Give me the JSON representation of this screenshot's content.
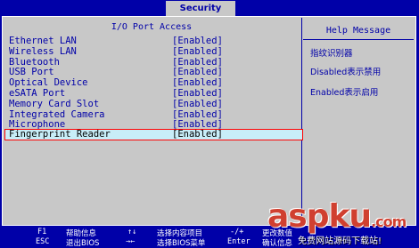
{
  "tabs": {
    "active": "Security"
  },
  "page": {
    "title": "I/O Port Access"
  },
  "items": [
    {
      "name": "Ethernet LAN",
      "value": "[Enabled]"
    },
    {
      "name": "Wireless LAN",
      "value": "[Enabled]"
    },
    {
      "name": "Bluetooth",
      "value": "[Enabled]"
    },
    {
      "name": "USB Port",
      "value": "[Enabled]"
    },
    {
      "name": "Optical Device",
      "value": "[Enabled]"
    },
    {
      "name": "eSATA Port",
      "value": "[Enabled]"
    },
    {
      "name": "Memory Card Slot",
      "value": "[Enabled]"
    },
    {
      "name": "Integrated Camera",
      "value": "[Enabled]"
    },
    {
      "name": "Microphone",
      "value": "[Enabled]"
    },
    {
      "name": "Fingerprint Reader",
      "value": "[Enabled]",
      "selected": true
    }
  ],
  "help": {
    "title": "Help Message",
    "lines": [
      "指纹识别器",
      "Disabled表示禁用",
      "Enabled表示启用"
    ]
  },
  "footer": {
    "f1_key": "F1",
    "f1_desc": "帮助信息",
    "esc_key": "ESC",
    "esc_desc": "退出BIOS",
    "updown_key": "↑↓",
    "updown_desc": "选择内容项目",
    "leftright_key": "→←",
    "leftright_desc": "选择BIOS菜单",
    "plusminus_key": "-/+",
    "plusminus_desc": "更改数值",
    "enter_key": "Enter",
    "enter_desc": "确认信息"
  },
  "watermark": {
    "logo": "aspku",
    "tld": ".com",
    "tagline": "免费网站源码下载站!"
  },
  "colors": {
    "background": "#0000a8",
    "panel": "#c8c8c8",
    "selected": "#c8eef8",
    "highlight_border": "#ff0000"
  }
}
